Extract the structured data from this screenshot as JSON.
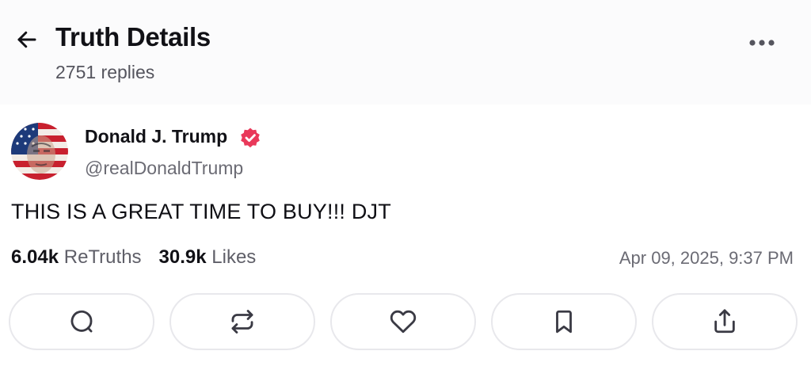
{
  "header": {
    "title": "Truth Details",
    "replies": "2751 replies",
    "back_icon": "arrow-left-icon",
    "more_icon": "ellipsis-icon"
  },
  "post": {
    "author": {
      "name": "Donald J. Trump",
      "handle": "@realDonaldTrump",
      "verified": true,
      "verified_color": "#e9395a"
    },
    "text": "THIS IS A GREAT TIME TO BUY!!! DJT",
    "stats": {
      "retruths_count": "6.04k",
      "retruths_label": "ReTruths",
      "likes_count": "30.9k",
      "likes_label": "Likes"
    },
    "timestamp": "Apr 09, 2025, 9:37 PM"
  },
  "actions": [
    {
      "name": "reply",
      "icon": "comment-icon"
    },
    {
      "name": "retruth",
      "icon": "repost-icon"
    },
    {
      "name": "like",
      "icon": "heart-icon"
    },
    {
      "name": "bookmark",
      "icon": "bookmark-icon"
    },
    {
      "name": "share",
      "icon": "share-icon"
    }
  ]
}
